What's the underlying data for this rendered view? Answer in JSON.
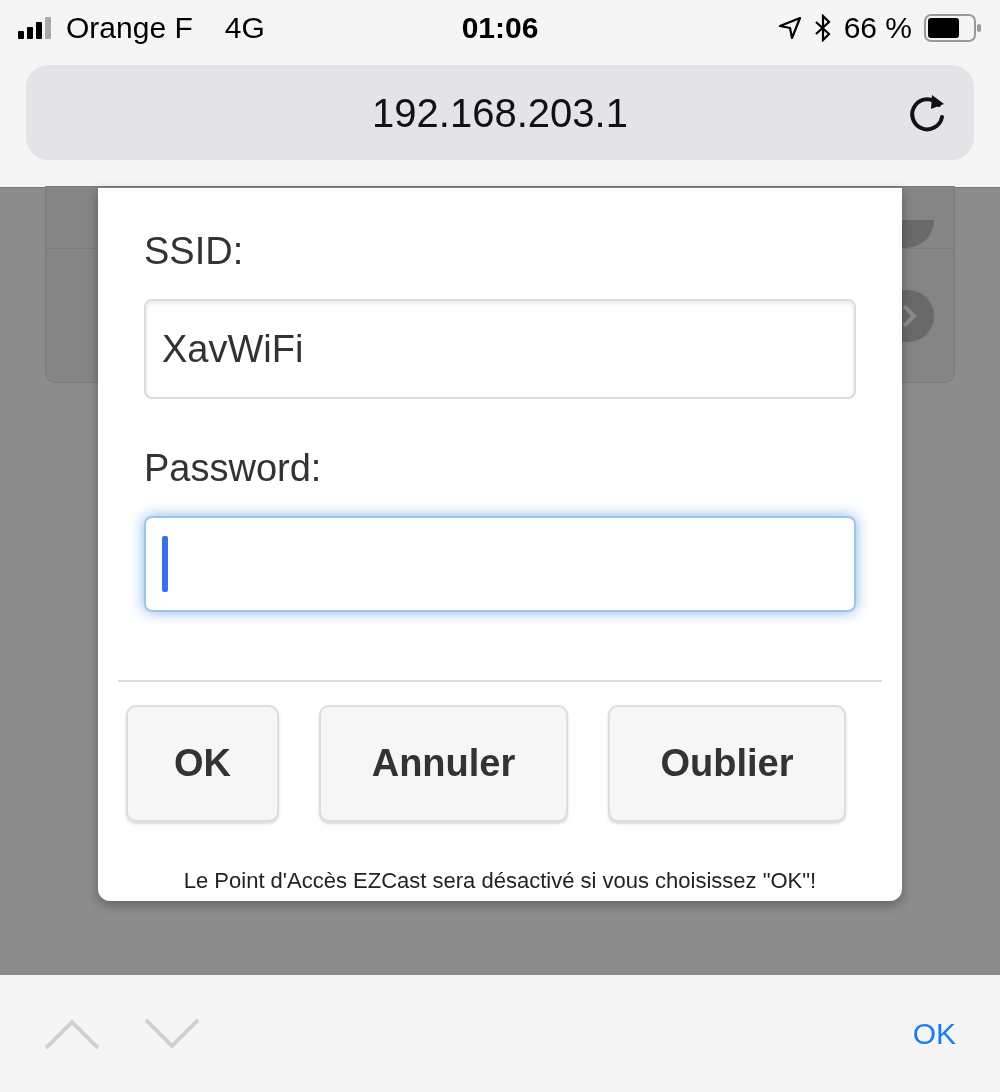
{
  "status_bar": {
    "carrier": "Orange F",
    "network": "4G",
    "time": "01:06",
    "battery": "66 %"
  },
  "address_bar": {
    "url": "192.168.203.1"
  },
  "dialog": {
    "fields": [
      {
        "label": "SSID:",
        "value": "XavWiFi",
        "focused": false
      },
      {
        "label": "Password:",
        "focused": true
      }
    ],
    "buttons": [
      "OK",
      "Annuler",
      "Oublier"
    ],
    "note": "Le Point d'Accès EZCast sera désactivé si vous choisissez \"OK\"!"
  },
  "keyboard_toolbar": {
    "done": "OK"
  }
}
